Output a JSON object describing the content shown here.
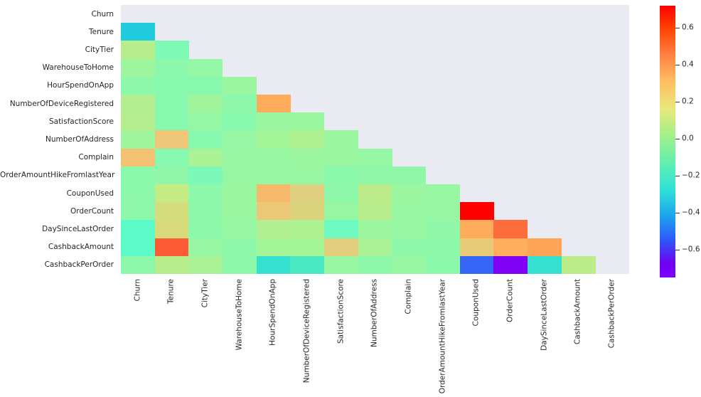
{
  "chart_data": {
    "type": "heatmap",
    "title": "",
    "xlabel": "",
    "ylabel": "",
    "grid": false,
    "colormap": "rainbow",
    "mask": "upper-triangle-including-diagonal",
    "colorbar": {
      "position": "right",
      "vmin": -0.75,
      "vmax": 0.72,
      "ticks": [
        0.6,
        0.4,
        0.2,
        0.0,
        -0.2,
        -0.4,
        -0.6
      ],
      "tick_labels": [
        "0.6",
        "0.4",
        "0.2",
        "0.0",
        "-0.2",
        "-0.4",
        "-0.6"
      ]
    },
    "categories": [
      "Churn",
      "Tenure",
      "CityTier",
      "WarehouseToHome",
      "HourSpendOnApp",
      "NumberOfDeviceRegistered",
      "SatisfactionScore",
      "NumberOfAddress",
      "Complain",
      "OrderAmountHikeFromlastYear",
      "CouponUsed",
      "OrderCount",
      "DaySinceLastOrder",
      "CashbackAmount",
      "CashbackPerOrder"
    ],
    "x_tick_labels": [
      "Churn",
      "Tenure",
      "CityTier",
      "WarehouseToHome",
      "HourSpendOnApp",
      "NumberOfDeviceRegistered",
      "SatisfactionScore",
      "NumberOfAddress",
      "Complain",
      "OrderAmountHikeFromlastYear",
      "CouponUsed",
      "OrderCount",
      "DaySinceLastOrder",
      "CashbackAmount",
      "CashbackPerOrder"
    ],
    "y_tick_labels": [
      "Churn",
      "Tenure",
      "CityTier",
      "WarehouseToHome",
      "HourSpendOnApp",
      "NumberOfDeviceRegistered",
      "SatisfactionScore",
      "NumberOfAddress",
      "Complain",
      "OrderAmountHikeFromlastYear",
      "CouponUsed",
      "OrderCount",
      "DaySinceLastOrder",
      "CashbackAmount",
      "CashbackPerOrder"
    ],
    "values": [
      [
        null,
        null,
        null,
        null,
        null,
        null,
        null,
        null,
        null,
        null,
        null,
        null,
        null,
        null,
        null
      ],
      [
        -0.35,
        null,
        null,
        null,
        null,
        null,
        null,
        null,
        null,
        null,
        null,
        null,
        null,
        null,
        null
      ],
      [
        0.12,
        -0.03,
        null,
        null,
        null,
        null,
        null,
        null,
        null,
        null,
        null,
        null,
        null,
        null,
        null
      ],
      [
        0.06,
        0.01,
        0.02,
        null,
        null,
        null,
        null,
        null,
        null,
        null,
        null,
        null,
        null,
        null,
        null
      ],
      [
        0.02,
        0.01,
        0.01,
        0.04,
        null,
        null,
        null,
        null,
        null,
        null,
        null,
        null,
        null,
        null,
        null
      ],
      [
        0.1,
        0.01,
        0.06,
        0.02,
        0.28,
        null,
        null,
        null,
        null,
        null,
        null,
        null,
        null,
        null,
        null
      ],
      [
        0.11,
        0.01,
        0.03,
        0.01,
        0.04,
        0.04,
        null,
        null,
        null,
        null,
        null,
        null,
        null,
        null,
        null
      ],
      [
        0.04,
        0.2,
        0.01,
        0.03,
        0.06,
        0.08,
        0.04,
        null,
        null,
        null,
        null,
        null,
        null,
        null,
        null
      ],
      [
        0.25,
        -0.01,
        0.05,
        0.03,
        0.03,
        0.04,
        0.04,
        0.03,
        null,
        null,
        null,
        null,
        null,
        null,
        null
      ],
      [
        0.01,
        0.02,
        -0.04,
        0.03,
        0.03,
        0.03,
        0.01,
        0.02,
        0.02,
        null,
        null,
        null,
        null,
        null,
        null
      ],
      [
        0.01,
        0.11,
        0.02,
        0.04,
        0.23,
        0.16,
        0.02,
        0.1,
        0.04,
        0.03,
        null,
        null,
        null,
        null,
        null
      ],
      [
        0.02,
        0.14,
        0.02,
        0.04,
        0.21,
        0.15,
        0.03,
        0.09,
        0.03,
        0.03,
        0.71,
        null,
        null,
        null,
        null
      ],
      [
        -0.16,
        0.16,
        0.02,
        0.03,
        0.09,
        0.08,
        -0.07,
        0.04,
        0.03,
        0.02,
        0.29,
        0.34,
        null,
        null,
        null
      ],
      [
        -0.15,
        0.47,
        0.03,
        0.02,
        0.06,
        0.06,
        0.18,
        0.07,
        0.02,
        0.02,
        0.18,
        0.25,
        0.26,
        null,
        null
      ],
      [
        0.02,
        0.11,
        0.06,
        0.02,
        -0.27,
        -0.25,
        0.03,
        0.02,
        0.03,
        0.01,
        -0.53,
        -0.71,
        -0.3,
        0.13,
        null
      ]
    ],
    "cell_colors": [
      [
        null,
        null,
        null,
        null,
        null,
        null,
        null,
        null,
        null,
        null,
        null,
        null,
        null,
        null,
        null
      ],
      [
        "#21ccdf",
        null,
        null,
        null,
        null,
        null,
        null,
        null,
        null,
        null,
        null,
        null,
        null,
        null,
        null
      ],
      [
        "#b8ed8c",
        "#7ef9b6",
        null,
        null,
        null,
        null,
        null,
        null,
        null,
        null,
        null,
        null,
        null,
        null,
        null
      ],
      [
        "#9cf69e",
        "#8bf8ab",
        "#93f7a5",
        null,
        null,
        null,
        null,
        null,
        null,
        null,
        null,
        null,
        null,
        null,
        null
      ],
      [
        "#8df8a9",
        "#88f8ae",
        "#88f8ae",
        "#9af69f",
        null,
        null,
        null,
        null,
        null,
        null,
        null,
        null,
        null,
        null,
        null
      ],
      [
        "#b3ee90",
        "#88f8ae",
        "#a0f59b",
        "#8df8a9",
        "#ffab5c",
        null,
        null,
        null,
        null,
        null,
        null,
        null,
        null,
        null,
        null
      ],
      [
        "#b6ed8e",
        "#88f8ae",
        "#94f7a4",
        "#88f8ae",
        "#9af69f",
        "#9af69f",
        null,
        null,
        null,
        null,
        null,
        null,
        null,
        null,
        null
      ],
      [
        "#9ef59c",
        "#eec579",
        "#88f8ae",
        "#95f7a3",
        "#a4f498",
        "#aef292",
        "#9af69f",
        null,
        null,
        null,
        null,
        null,
        null,
        null,
        null
      ],
      [
        "#f3c172",
        "#85f9b0",
        "#a9f396",
        "#97f6a2",
        "#97f6a2",
        "#9af69f",
        "#9af69f",
        "#95f7a3",
        null,
        null,
        null,
        null,
        null,
        null,
        null
      ],
      [
        "#8bf8ab",
        "#8ff7a7",
        "#7cf9b8",
        "#97f6a2",
        "#97f6a2",
        "#97f6a2",
        "#8bf8ab",
        "#8ff7a7",
        "#8ff7a7",
        null,
        null,
        null,
        null,
        null,
        null
      ],
      [
        "#8bf8ab",
        "#c5eb84",
        "#8df8a9",
        "#9af69f",
        "#f6b96b",
        "#e0d07f",
        "#8df8a9",
        "#bcec89",
        "#9af69f",
        "#97f6a2",
        null,
        null,
        null,
        null,
        null
      ],
      [
        "#8df8a9",
        "#d3dd7c",
        "#8df8a9",
        "#9af69f",
        "#ecc777",
        "#dbd47d",
        "#97f6a2",
        "#b8ed8c",
        "#97f6a2",
        "#97f6a2",
        "#ff0000",
        null,
        null,
        null,
        null
      ],
      [
        "#5bfbca",
        "#d7da7b",
        "#8df8a9",
        "#97f6a2",
        "#b1ef91",
        "#aef292",
        "#6efac1",
        "#9af69f",
        "#97f6a2",
        "#8ff7a7",
        "#ffab5c",
        "#fd6c3b",
        null,
        null,
        null
      ],
      [
        "#5dfbc8",
        "#fd5b36",
        "#97f6a2",
        "#8df8a9",
        "#a4f498",
        "#a4f498",
        "#e3ce7e",
        "#a9f396",
        "#8df8a9",
        "#8df8a9",
        "#e8cb79",
        "#ffae5e",
        "#ffa558",
        null,
        null
      ],
      [
        "#8df8a9",
        "#b8ed8c",
        "#a9f396",
        "#8df8a9",
        "#36e0ce",
        "#4ae7c3",
        "#97f6a2",
        "#8df8a9",
        "#97f6a2",
        "#8bf8ab",
        "#3666f5",
        "#8000f5",
        "#36e0ce",
        "#bcec89",
        null
      ]
    ]
  },
  "axes": {
    "background_color": "#eaeaf2",
    "figure_background": "#ffffff"
  }
}
